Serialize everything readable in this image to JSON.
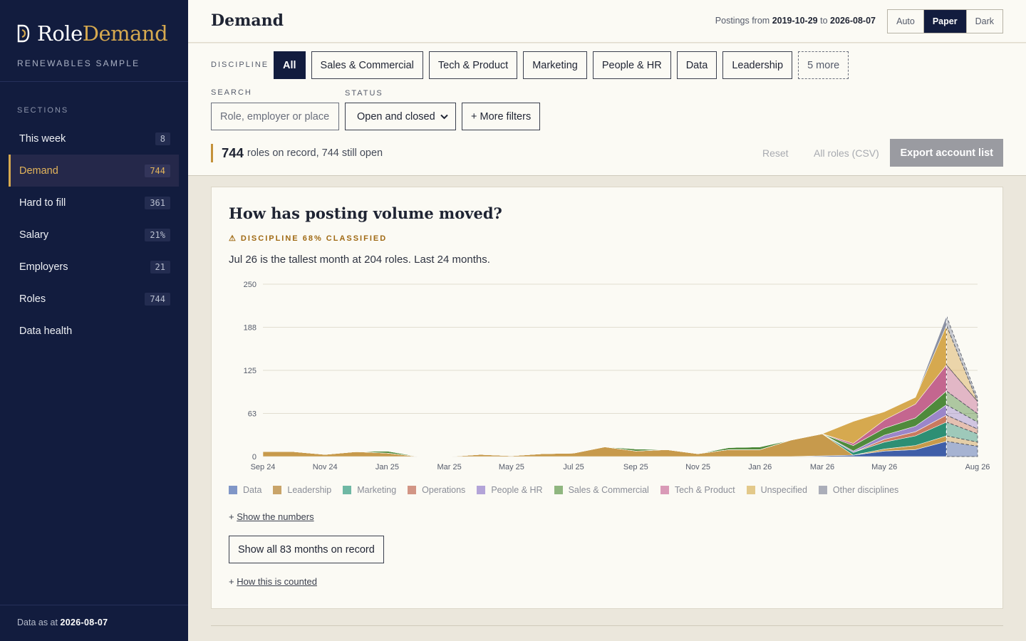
{
  "brand": {
    "name_first": "Role",
    "name_second": "Demand",
    "subtitle": "RENEWABLES SAMPLE"
  },
  "sidebar": {
    "section_label": "SECTIONS",
    "items": [
      {
        "label": "This week",
        "badge": "8"
      },
      {
        "label": "Demand",
        "badge": "744",
        "active": true
      },
      {
        "label": "Hard to fill",
        "badge": "361"
      },
      {
        "label": "Salary",
        "badge": "21%"
      },
      {
        "label": "Employers",
        "badge": "21"
      },
      {
        "label": "Roles",
        "badge": "744"
      },
      {
        "label": "Data health",
        "badge": ""
      }
    ],
    "footer_prefix": "Data as at",
    "footer_date": "2026-08-07"
  },
  "header": {
    "title": "Demand",
    "postings_prefix": "Postings from",
    "postings_from": "2019-10-29",
    "postings_to_word": "to",
    "postings_to": "2026-08-07",
    "themes": [
      "Auto",
      "Paper",
      "Dark"
    ],
    "active_theme": "Paper"
  },
  "filters": {
    "discipline_label": "DISCIPLINE",
    "disciplines": [
      "All",
      "Sales & Commercial",
      "Tech & Product",
      "Marketing",
      "People & HR",
      "Data",
      "Leadership"
    ],
    "more_label": "5 more",
    "search_label": "SEARCH",
    "search_placeholder": "Role, employer or place",
    "status_label": "STATUS",
    "status_value": "Open and closed",
    "more_filters": "+ More filters",
    "summary_count": "744",
    "summary_text": "roles on record, 744 still open",
    "reset": "Reset",
    "csv": "All roles (CSV)",
    "export": "Export account list"
  },
  "card": {
    "title": "How has posting volume moved?",
    "warning": "⚠ DISCIPLINE 68% CLASSIFIED",
    "subtitle": "Jul 26 is the tallest month at 204 roles. Last 24 months.",
    "show_numbers": "Show the numbers",
    "show_all": "Show all 83 months on record",
    "how_counted": "How this is counted",
    "plus": "+"
  },
  "chart_data": {
    "type": "area",
    "stacked": true,
    "ylim": [
      0,
      250
    ],
    "yticks": [
      "0",
      "63",
      "125",
      "188",
      "250"
    ],
    "x": [
      "Sep 24",
      "Oct 24",
      "Nov 24",
      "Dec 24",
      "Jan 25",
      "Feb 25",
      "Mar 25",
      "Apr 25",
      "May 25",
      "Jun 25",
      "Jul 25",
      "Aug 25",
      "Sep 25",
      "Oct 25",
      "Nov 25",
      "Dec 25",
      "Jan 26",
      "Feb 26",
      "Mar 26",
      "Apr 26",
      "May 26",
      "Jun 26",
      "Jul 26",
      "Aug 26"
    ],
    "xtick_labels": [
      "Sep 24",
      "Nov 24",
      "Jan 25",
      "Mar 25",
      "May 25",
      "Jul 25",
      "Sep 25",
      "Nov 25",
      "Jan 26",
      "Mar 26",
      "May 26",
      "Aug 26"
    ],
    "partial_last_month": true,
    "series": [
      {
        "name": "Data",
        "color": "#3f5ea8",
        "values": [
          0,
          0,
          0,
          0,
          0,
          0,
          0,
          0,
          0,
          0,
          0,
          0,
          0,
          0,
          0,
          0,
          0,
          0,
          1,
          2,
          8,
          10,
          22,
          15
        ]
      },
      {
        "name": "Leadership",
        "color": "#c79a4c",
        "values": [
          7,
          7,
          3,
          7,
          5,
          0,
          0,
          3,
          1,
          4,
          5,
          14,
          8,
          10,
          4,
          10,
          10,
          24,
          32,
          0,
          3,
          6,
          8,
          6
        ]
      },
      {
        "name": "Marketing",
        "color": "#2d8f74",
        "values": [
          0,
          0,
          0,
          0,
          0,
          0,
          0,
          0,
          0,
          0,
          0,
          0,
          0,
          0,
          0,
          0,
          0,
          0,
          0,
          4,
          10,
          14,
          20,
          12
        ]
      },
      {
        "name": "Operations",
        "color": "#c97a5f",
        "values": [
          0,
          0,
          0,
          0,
          0,
          0,
          0,
          0,
          0,
          0,
          0,
          0,
          0,
          0,
          0,
          0,
          0,
          0,
          0,
          0,
          4,
          6,
          10,
          7
        ]
      },
      {
        "name": "People & HR",
        "color": "#9b86c9",
        "values": [
          0,
          0,
          0,
          0,
          0,
          0,
          0,
          0,
          0,
          0,
          0,
          0,
          0,
          0,
          0,
          0,
          0,
          0,
          0,
          2,
          6,
          8,
          15,
          10
        ]
      },
      {
        "name": "Sales & Commercial",
        "color": "#4f8a3c",
        "values": [
          0,
          0,
          0,
          0,
          3,
          0,
          0,
          0,
          0,
          0,
          0,
          0,
          3,
          0,
          0,
          3,
          4,
          0,
          0,
          8,
          10,
          12,
          20,
          12
        ]
      },
      {
        "name": "Tech & Product",
        "color": "#c4668f",
        "values": [
          0,
          0,
          0,
          0,
          0,
          0,
          0,
          0,
          0,
          0,
          0,
          0,
          0,
          0,
          0,
          0,
          0,
          0,
          0,
          3,
          12,
          20,
          38,
          18
        ]
      },
      {
        "name": "Unspecified",
        "color": "#d6a94f",
        "values": [
          0,
          0,
          0,
          0,
          0,
          0,
          0,
          0,
          0,
          0,
          0,
          0,
          0,
          0,
          0,
          0,
          0,
          0,
          0,
          32,
          12,
          10,
          57,
          0
        ]
      },
      {
        "name": "Other disciplines",
        "color": "#8a90a3",
        "values": [
          0,
          0,
          0,
          0,
          0,
          0,
          0,
          0,
          0,
          0,
          0,
          0,
          0,
          0,
          0,
          0,
          0,
          0,
          0,
          0,
          0,
          0,
          14,
          5
        ]
      }
    ],
    "legend": [
      "Data",
      "Leadership",
      "Marketing",
      "Operations",
      "People & HR",
      "Sales & Commercial",
      "Tech & Product",
      "Unspecified",
      "Other disciplines"
    ],
    "legend_colors": [
      "#8096c7",
      "#c9a469",
      "#6fb8a4",
      "#d29585",
      "#b3a4d8",
      "#8fb67f",
      "#d99ab7",
      "#e3c98a",
      "#abaeb9"
    ]
  }
}
